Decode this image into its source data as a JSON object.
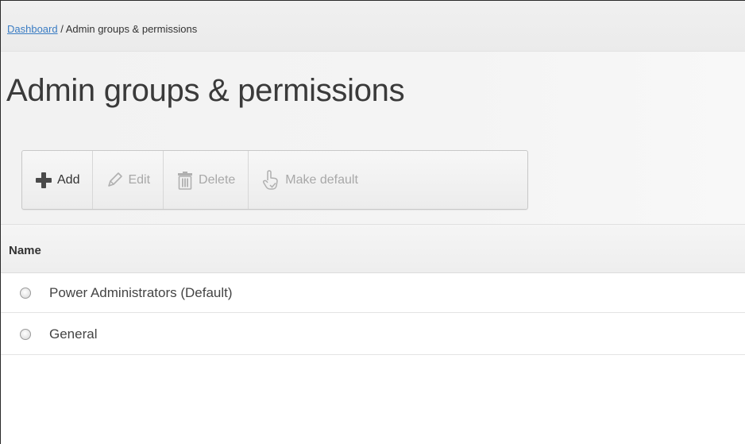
{
  "breadcrumb": {
    "link": "Dashboard",
    "separator": " / ",
    "current": "Admin groups & permissions"
  },
  "page_title": "Admin groups & permissions",
  "toolbar": {
    "add": {
      "label": "Add",
      "icon": "plus-icon",
      "enabled": true
    },
    "edit": {
      "label": "Edit",
      "icon": "pencil-icon",
      "enabled": false
    },
    "delete": {
      "label": "Delete",
      "icon": "trash-icon",
      "enabled": false
    },
    "make_default": {
      "label": "Make default",
      "icon": "hand-pointer-icon",
      "enabled": false
    }
  },
  "table": {
    "columns": [
      "Name"
    ],
    "rows": [
      {
        "name": "Power Administrators (Default)",
        "selected": false
      },
      {
        "name": "General",
        "selected": false
      }
    ]
  },
  "colors": {
    "link": "#3a7cc3",
    "disabled_text": "#a8a8a8",
    "text": "#333333"
  }
}
